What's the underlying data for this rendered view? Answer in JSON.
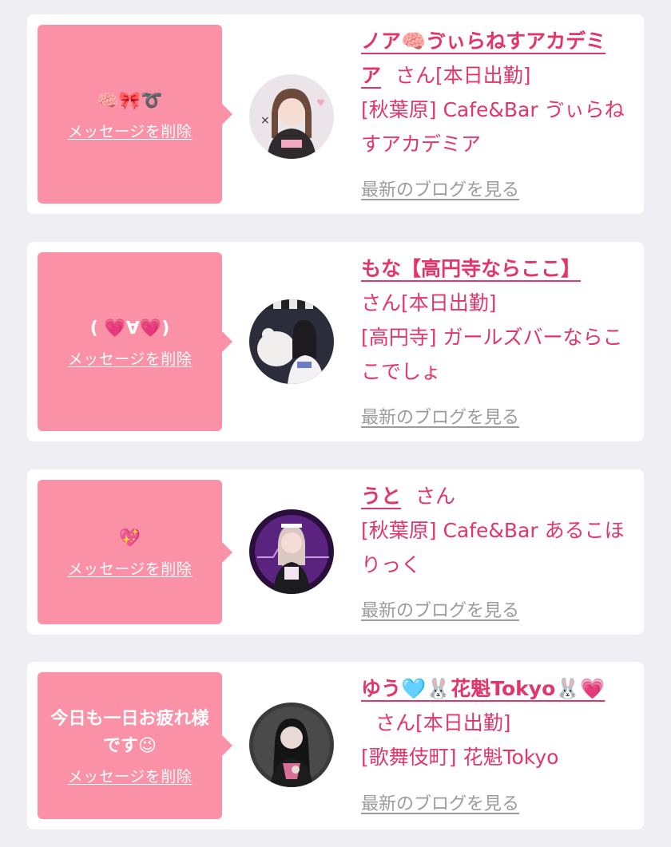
{
  "messages": [
    {
      "message_text": "🧠🎀➰",
      "delete_label": "メッセージを削除",
      "cast_name": "ノア🧠ゔぃらねすアカデミア",
      "honorific": "さん",
      "work_status": "[本日出勤]",
      "shop": "[秋葉原] Cafe&Bar ゔぃらねすアカデミア",
      "blog_label": "最新のブログを見る",
      "avatar_colors": [
        "#e9e2e8",
        "#f4a9c0",
        "#3a2f33"
      ]
    },
    {
      "message_text": "( 💗∀💗)",
      "delete_label": "メッセージを削除",
      "cast_name": "もな【高円寺ならここ】",
      "honorific": "さん",
      "work_status": "[本日出勤]",
      "shop": "[高円寺] ガールズバーならここでしょ",
      "blog_label": "最新のブログを見る",
      "avatar_colors": [
        "#2b2d3a",
        "#f1efee",
        "#6d7cc7"
      ]
    },
    {
      "message_text": "💖",
      "delete_label": "メッセージを削除",
      "cast_name": "うと",
      "honorific": "さん",
      "work_status": "",
      "shop": "[秋葉原] Cafe&Bar あるこほりっく",
      "blog_label": "最新のブログを見る",
      "avatar_colors": [
        "#2a0f3b",
        "#8d3fb7",
        "#f3e6ee"
      ]
    },
    {
      "message_text": "今日も一日お疲れ様です😉",
      "delete_label": "メッセージを削除",
      "cast_name": "ゆう🩵🐰花魁Tokyo🐰💗",
      "honorific": "さん",
      "work_status": "[本日出勤]",
      "shop": "[歌舞伎町] 花魁Tokyo",
      "blog_label": "最新のブログを見る",
      "avatar_colors": [
        "#3b3b3b",
        "#1c1c1c",
        "#e9d9d5"
      ]
    }
  ]
}
